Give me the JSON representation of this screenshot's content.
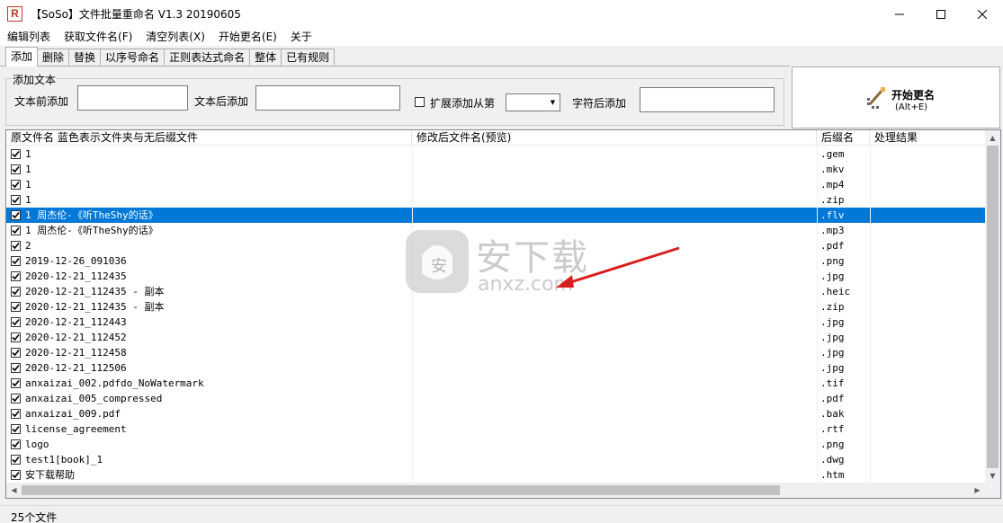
{
  "window": {
    "title": "【SoSo】文件批量重命名    V1.3 20190605",
    "minimize_icon": "minimize-icon",
    "maximize_icon": "maximize-icon",
    "close_icon": "close-icon"
  },
  "menu": [
    "编辑列表",
    "获取文件名(F)",
    "清空列表(X)",
    "开始更名(E)",
    "关于"
  ],
  "tabs": [
    "添加",
    "删除",
    "替换",
    "以序号命名",
    "正则表达式命名",
    "整体",
    "已有规则"
  ],
  "add_panel": {
    "group_label": "添加文本",
    "before_label": "文本前添加",
    "after_label": "文本后添加",
    "extend_label": "扩展添加从第",
    "after_char_label": "字符后添加",
    "before_value": "",
    "after_value": "",
    "after_char_value": ""
  },
  "start_button": {
    "label": "开始更名",
    "shortcut": "(Alt+E)"
  },
  "list": {
    "columns": [
      "原文件名 蓝色表示文件夹与无后缀文件",
      "修改后文件名(预览)",
      "后缀名",
      "处理结果"
    ],
    "rows": [
      {
        "name": "1",
        "ext": ".gem"
      },
      {
        "name": "1",
        "ext": ".mkv"
      },
      {
        "name": "1",
        "ext": ".mp4"
      },
      {
        "name": "1",
        "ext": ".zip"
      },
      {
        "name": "1 周杰伦-《听TheShy的话》",
        "ext": ".flv",
        "selected": true
      },
      {
        "name": "1 周杰伦-《听TheShy的话》",
        "ext": ".mp3"
      },
      {
        "name": "2",
        "ext": ".pdf"
      },
      {
        "name": "2019-12-26_091036",
        "ext": ".png"
      },
      {
        "name": "2020-12-21_112435",
        "ext": ".jpg"
      },
      {
        "name": "2020-12-21_112435 - 副本",
        "ext": ".heic"
      },
      {
        "name": "2020-12-21_112435 - 副本",
        "ext": ".zip"
      },
      {
        "name": "2020-12-21_112443",
        "ext": ".jpg"
      },
      {
        "name": "2020-12-21_112452",
        "ext": ".jpg"
      },
      {
        "name": "2020-12-21_112458",
        "ext": ".jpg"
      },
      {
        "name": "2020-12-21_112506",
        "ext": ".jpg"
      },
      {
        "name": "anxaizai_002.pdfdo_NoWatermark",
        "ext": ".tif"
      },
      {
        "name": "anxaizai_005_compressed",
        "ext": ".pdf"
      },
      {
        "name": "anxaizai_009.pdf",
        "ext": ".bak"
      },
      {
        "name": "license_agreement",
        "ext": ".rtf"
      },
      {
        "name": "logo",
        "ext": ".png"
      },
      {
        "name": "test1[book]_1",
        "ext": ".dwg"
      },
      {
        "name": "安下载帮助",
        "ext": ".htm"
      }
    ]
  },
  "status": {
    "text": "25个文件"
  },
  "watermark": {
    "cn": "安下载",
    "en": "anxz.com"
  },
  "colors": {
    "selection": "#0078d7",
    "accent_red": "#c0392b"
  }
}
